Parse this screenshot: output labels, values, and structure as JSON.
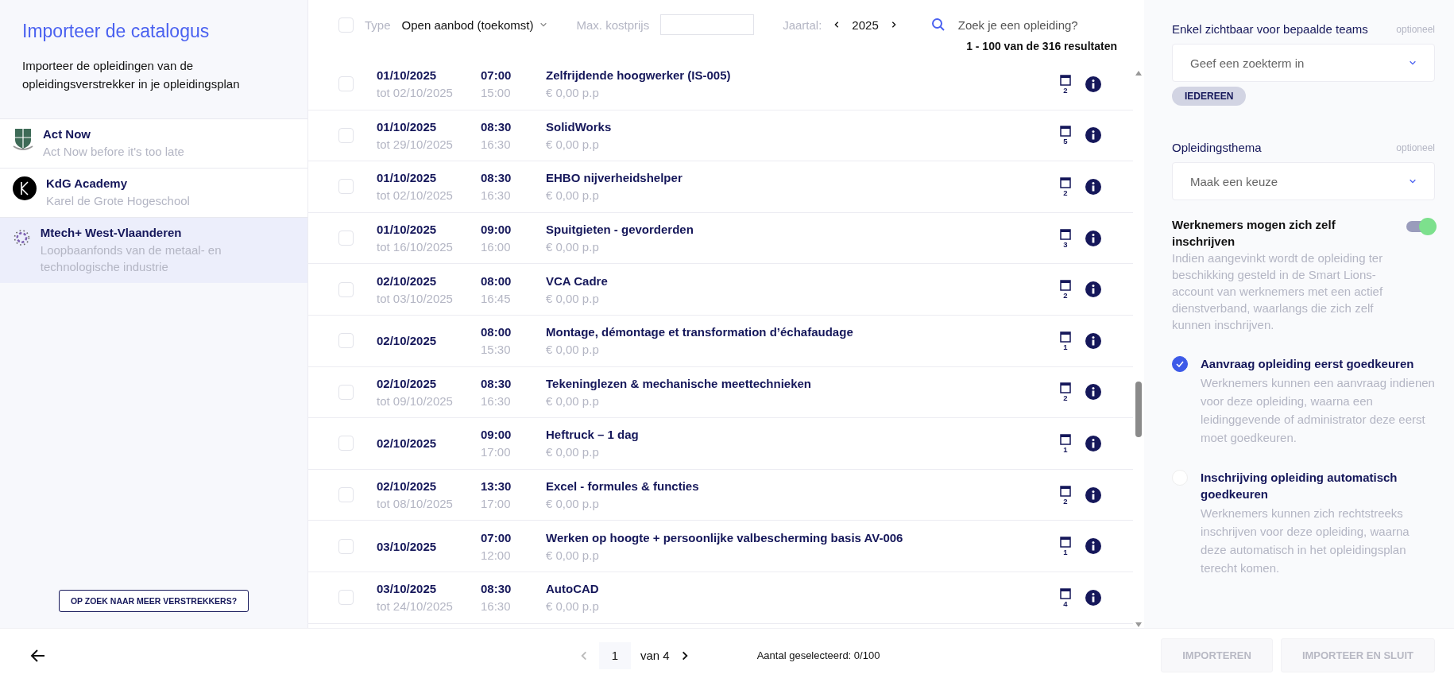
{
  "sidebar": {
    "title": "Importeer de catalogus",
    "description": "Importeer de opleidingen van de opleidingsverstrekker in je opleidingsplan",
    "providers": [
      {
        "name": "Act Now",
        "subtitle": "Act Now before it's too late",
        "kind": "crest",
        "selected": false
      },
      {
        "name": "KdG Academy",
        "subtitle": "Karel de Grote Hogeschool",
        "kind": "letter",
        "selected": false
      },
      {
        "name": "Mtech+ West-Vlaanderen",
        "subtitle": "Loopbaanfonds van de metaal- en technologische industrie",
        "kind": "gear",
        "selected": true
      }
    ],
    "more_button": "OP ZOEK NAAR MEER VERSTREKKERS?"
  },
  "toolbar": {
    "select_all_checked": false,
    "type_label": "Type",
    "type_value": "Open aanbod (toekomst)",
    "cost_label": "Max. kostprijs",
    "year_label": "Jaartal:",
    "year": "2025",
    "search_placeholder": "Zoek je een opleiding?",
    "results": "1 - 100 van de 316 resultaten"
  },
  "rows": [
    {
      "checked": false,
      "date": "01/10/2025",
      "end_date": "tot 02/10/2025",
      "start": "07:00",
      "end": "15:00",
      "title": "Zelfrijdende hoogwerker (IS-005)",
      "price": "€ 0,00 p.p",
      "sessions": "2"
    },
    {
      "checked": false,
      "date": "01/10/2025",
      "end_date": "tot 29/10/2025",
      "start": "08:30",
      "end": "16:30",
      "title": "SolidWorks",
      "price": "€ 0,00 p.p",
      "sessions": "5"
    },
    {
      "checked": false,
      "date": "01/10/2025",
      "end_date": "tot 02/10/2025",
      "start": "08:30",
      "end": "16:30",
      "title": "EHBO nijverheidshelper",
      "price": "€ 0,00 p.p",
      "sessions": "2"
    },
    {
      "checked": false,
      "date": "01/10/2025",
      "end_date": "tot 16/10/2025",
      "start": "09:00",
      "end": "16:00",
      "title": "Spuitgieten - gevorderden",
      "price": "€ 0,00 p.p",
      "sessions": "3"
    },
    {
      "checked": false,
      "date": "02/10/2025",
      "end_date": "tot 03/10/2025",
      "start": "08:00",
      "end": "16:45",
      "title": "VCA Cadre",
      "price": "€ 0,00 p.p",
      "sessions": "2"
    },
    {
      "checked": false,
      "date": "02/10/2025",
      "start": "08:00",
      "end": "15:30",
      "title": "Montage, démontage et transformation d’échafaudage",
      "price": "€ 0,00 p.p",
      "sessions": "1"
    },
    {
      "checked": false,
      "date": "02/10/2025",
      "end_date": "tot 09/10/2025",
      "start": "08:30",
      "end": "16:30",
      "title": "Tekeninglezen & mechanische meettechnieken",
      "price": "€ 0,00 p.p",
      "sessions": "2"
    },
    {
      "checked": false,
      "date": "02/10/2025",
      "start": "09:00",
      "end": "17:00",
      "title": "Heftruck – 1 dag",
      "price": "€ 0,00 p.p",
      "sessions": "1"
    },
    {
      "checked": false,
      "date": "02/10/2025",
      "end_date": "tot 08/10/2025",
      "start": "13:30",
      "end": "17:00",
      "title": "Excel - formules & functies",
      "price": "€ 0,00 p.p",
      "sessions": "2"
    },
    {
      "checked": false,
      "date": "03/10/2025",
      "start": "07:00",
      "end": "12:00",
      "title": "Werken op hoogte + persoonlijke valbescherming basis AV-006",
      "price": "€ 0,00 p.p",
      "sessions": "1"
    },
    {
      "checked": false,
      "date": "03/10/2025",
      "end_date": "tot 24/10/2025",
      "start": "08:30",
      "end": "16:30",
      "title": "AutoCAD",
      "price": "€ 0,00 p.p",
      "sessions": "4"
    }
  ],
  "settings": {
    "teams": {
      "label": "Enkel zichtbaar voor bepaalde teams",
      "optional": "optioneel",
      "placeholder": "Geef een zoekterm in",
      "chip": "IEDEREEN"
    },
    "theme": {
      "label": "Opleidingsthema",
      "optional": "optioneel",
      "placeholder": "Maak een keuze"
    },
    "self_enroll": {
      "title": "Werknemers mogen zich zelf inschrijven",
      "on": true,
      "description": "Indien aangevinkt wordt de opleiding ter beschikking gesteld in de Smart Lions-account van werknemers met een actief dienstverband, waarlangs die zich zelf kunnen inschrijven."
    },
    "options": [
      {
        "title": "Aanvraag opleiding eerst goedkeuren",
        "description": "Werknemers kunnen een aanvraag indienen voor deze opleiding, waarna een leidinggevende of administrator deze eerst moet goedkeuren.",
        "selected": true
      },
      {
        "title": "Inschrijving opleiding automatisch goedkeuren",
        "description": "Werknemers kunnen zich rechtstreeks inschrijven voor deze opleiding, waarna deze automatisch in het opleidingsplan terecht komen.",
        "selected": false
      }
    ]
  },
  "footer": {
    "page": "1",
    "of": "van 4",
    "selected_count": "Aantal geselecteerd: 0/100",
    "buttons": [
      "IMPORTEREN",
      "IMPORTEER EN SLUIT"
    ]
  }
}
